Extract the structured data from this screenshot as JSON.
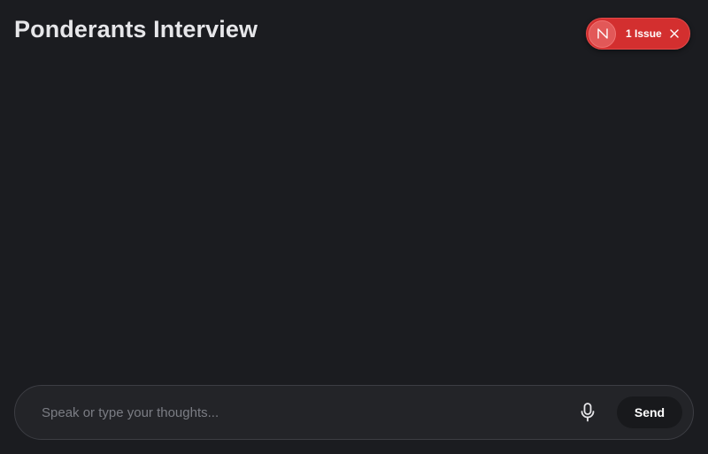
{
  "header": {
    "title": "Ponderants Interview"
  },
  "issue_badge": {
    "logo_letter": "N",
    "label": "1 Issue",
    "color": "#d32f2f"
  },
  "composer": {
    "placeholder": "Speak or type your thoughts...",
    "value": "",
    "send_label": "Send"
  },
  "icons": {
    "logo": "n-logo-icon",
    "dismiss": "close-icon",
    "microphone": "microphone-icon"
  },
  "theme": {
    "background": "#1b1c20",
    "input_background": "#232428",
    "send_button": "#18191c"
  }
}
